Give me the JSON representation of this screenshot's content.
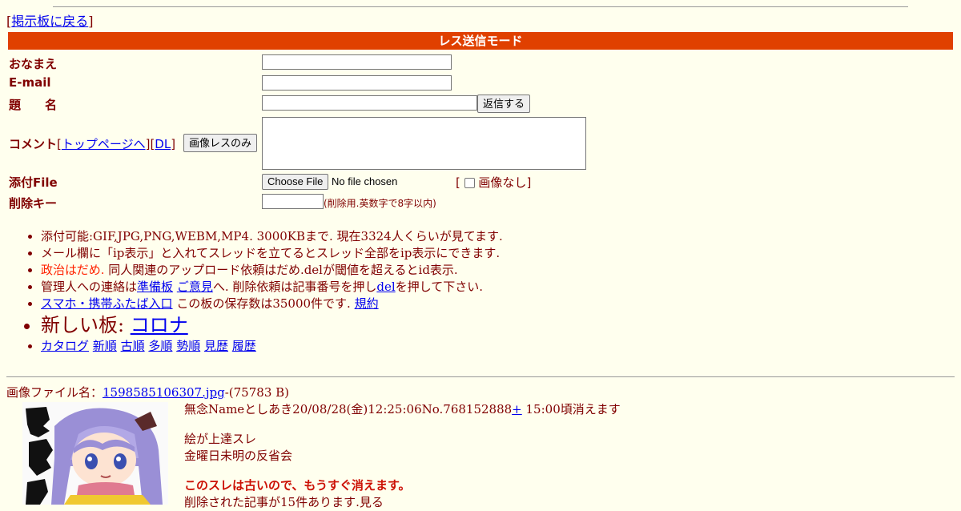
{
  "nav": {
    "back_link": "掲示板に戻る",
    "open": "[",
    "close": "]"
  },
  "form": {
    "mode_title": "レス送信モード",
    "name_label": "おなまえ",
    "email_label": "E-mail",
    "subject_label": "題　　名",
    "submit_label": "返信する",
    "comment_label": "コメント",
    "top_page_link": "トップページへ",
    "dl_link": "DL",
    "image_only_label": "画像レスのみ",
    "file_label": "添付File",
    "choose_file_label": "Choose File",
    "no_file_text": "No file chosen",
    "no_image_label": "画像なし",
    "delete_key_label": "削除キー",
    "delete_key_hint": "(削除用.英数字で8字以内)"
  },
  "rules": {
    "line1": "添付可能:GIF,JPG,PNG,WEBM,MP4. 3000KBまで. 現在3324人くらいが見てます.",
    "line2": "メール欄に「ip表示」と入れてスレッドを立てるとスレッド全部をip表示にできます.",
    "line3_red": "政治はだめ.",
    "line3_rest": " 同人関連のアップロード依頼はだめ.delが閾値を超えるとid表示.",
    "line4_pre": "管理人への連絡は",
    "line4_link1": "準備板",
    "line4_link2": "ご意見",
    "line4_mid": "へ. 削除依頼は記事番号を押し",
    "line4_link3": "del",
    "line4_post": "を押して下さい.",
    "line5_link": "スマホ・携帯ふたば入口",
    "line5_mid": " この板の保存数は35000件です. ",
    "line5_link2": "規約",
    "line6_pre": "新しい板: ",
    "line6_link": "コロナ",
    "catalog_links": [
      "カタログ",
      "新順",
      "古順",
      "多順",
      "勢順",
      "見歴",
      "履歴"
    ]
  },
  "post": {
    "file_label": "画像ファイル名：",
    "file_name": "1598585106307.jpg",
    "file_size": "-(75783 B)",
    "header": "無念Nameとしあき20/08/28(金)12:25:06No.768152888",
    "plus": "+",
    "expire": " 15:00頃消えます",
    "body_line1": "絵が上達スレ",
    "body_line2": "金曜日未明の反省会",
    "warning": "このスレは古いので、もうすぐ消えます。",
    "deleted": "削除された記事が15件あります.見る"
  },
  "colors": {
    "accent": "#e04000",
    "background": "#ffffee",
    "text": "#800000"
  }
}
